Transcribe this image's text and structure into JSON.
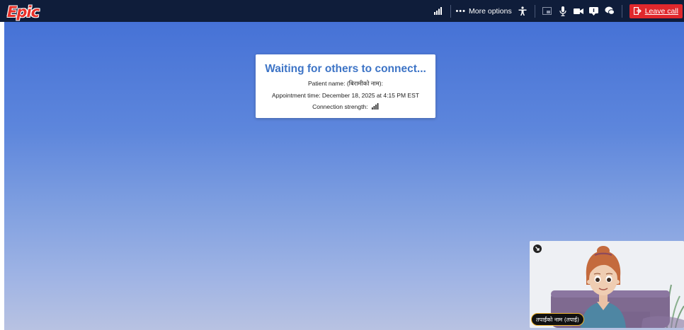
{
  "app": {
    "logo_text": "Epic"
  },
  "toolbar": {
    "more_options_label": "More options",
    "leave_call_label": "Leave call",
    "icons": [
      "signal-strength-icon",
      "more-dots-icon",
      "accessibility-icon",
      "screen-share-icon",
      "microphone-icon",
      "camera-icon",
      "chat-bubble-icon",
      "chat-bubbles-icon",
      "leave-icon"
    ]
  },
  "dialog": {
    "title": "Waiting for others to connect...",
    "patient_line": "Patient name: (बिरामीको नाम):",
    "appointment_line": "Appointment time: December 18, 2025 at 4:15 PM EST",
    "connection_label": "Connection strength:"
  },
  "self_view": {
    "name_label": "तपाईंको नाम (तपाई)"
  },
  "colors": {
    "topbar": "#0f1d3a",
    "accent": "#3d74c6",
    "leave_button": "#e0282c",
    "name_pill_border": "#f1b52c"
  }
}
